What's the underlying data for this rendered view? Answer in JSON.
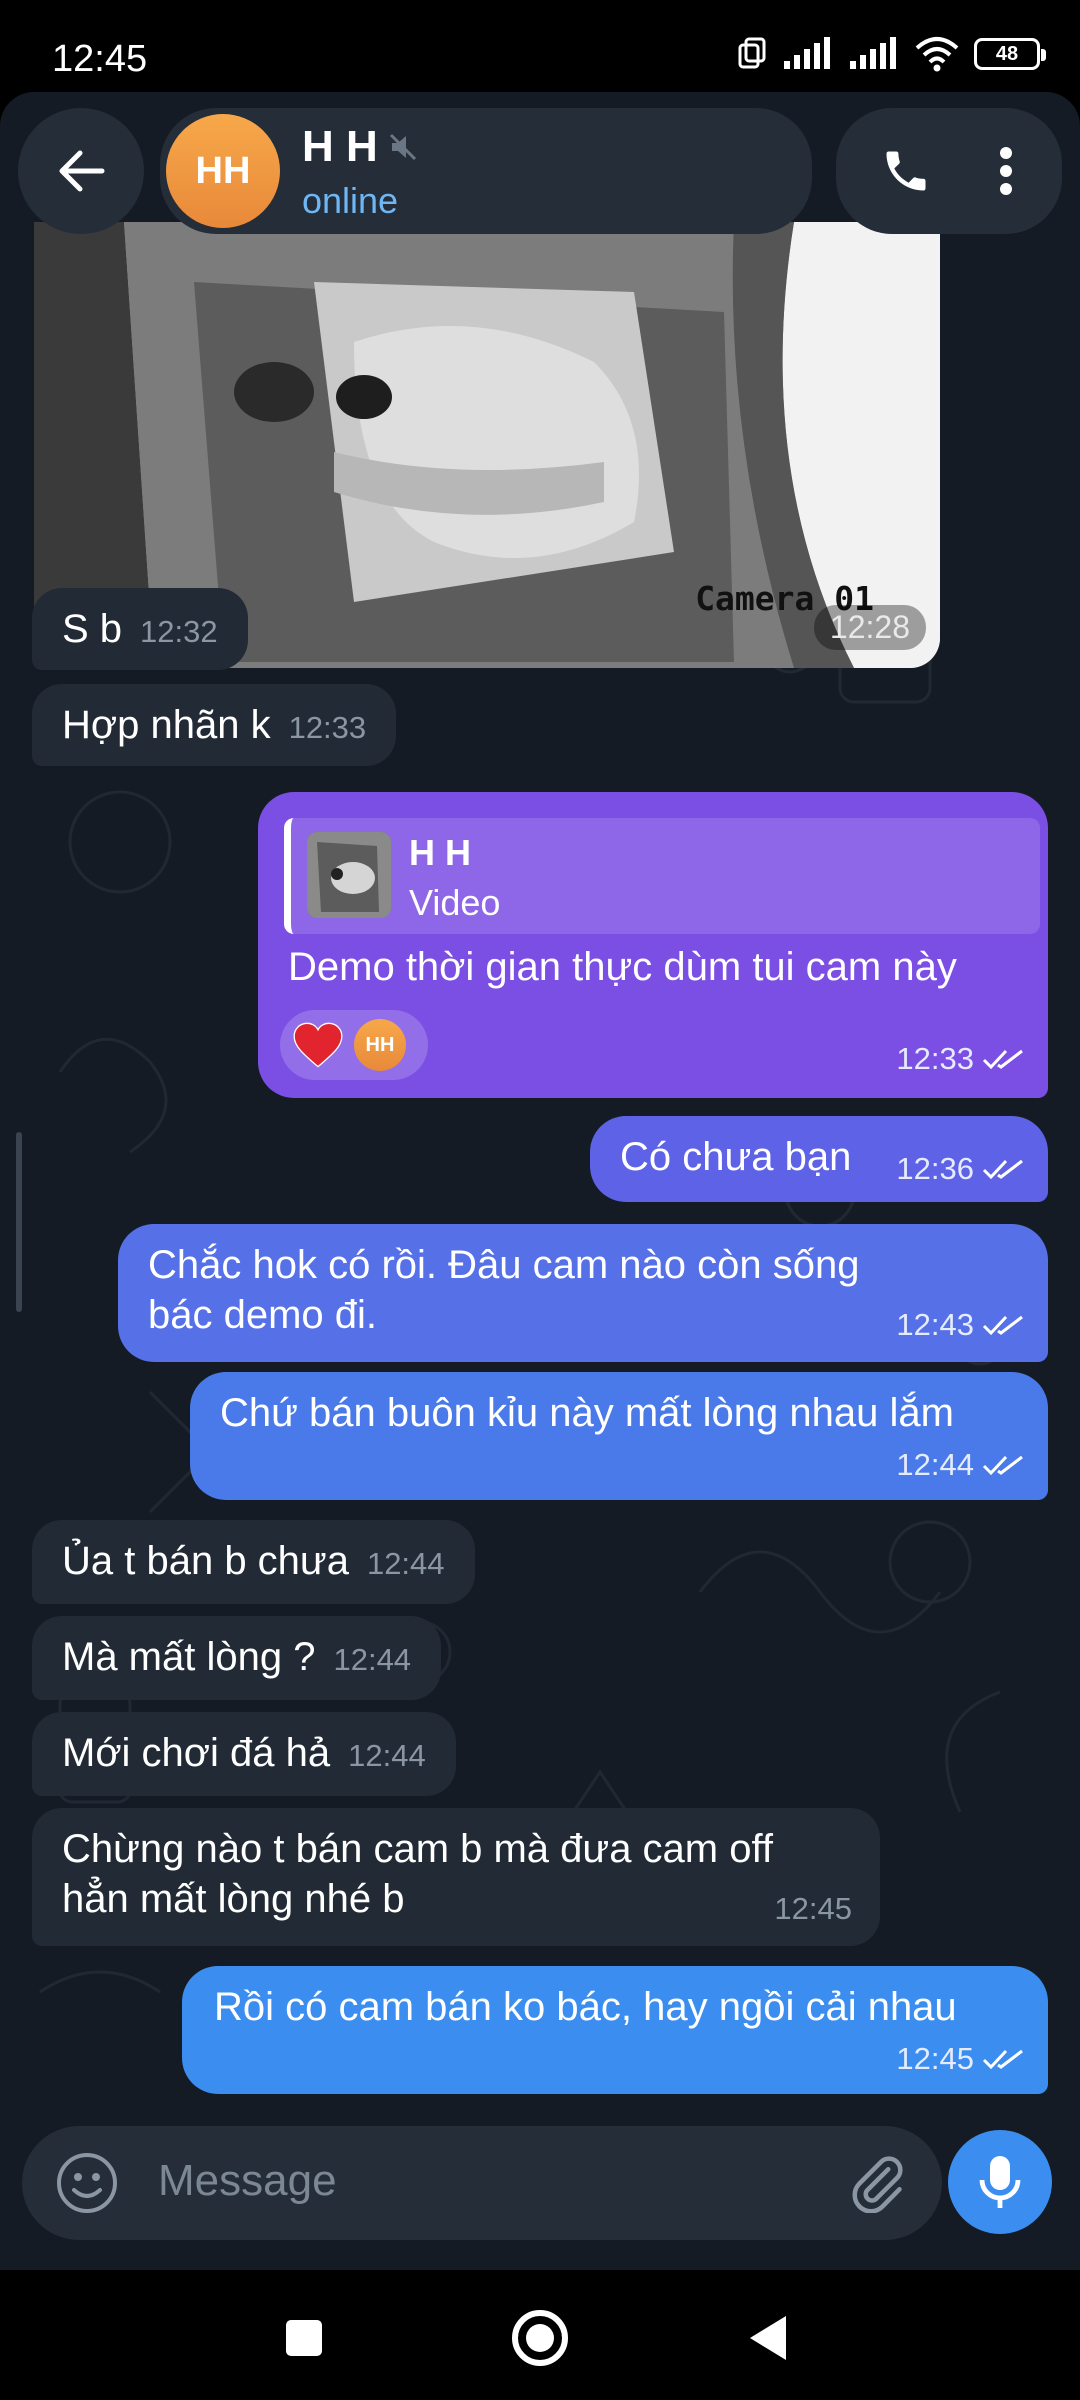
{
  "status_bar": {
    "time": "12:45",
    "battery": "48"
  },
  "header": {
    "avatar_initials": "HH",
    "name": "H H",
    "status": "online"
  },
  "photo": {
    "overlay_text": "Camera 01",
    "time": "12:28"
  },
  "messages": [
    {
      "side": "in",
      "text": "S b",
      "time": "12:32"
    },
    {
      "side": "in",
      "text": "Hợp nhãn k",
      "time": "12:33"
    },
    {
      "side": "out",
      "reply_name": "H H",
      "reply_type": "Video",
      "text": "Demo thời gian thực dùm tui cam này",
      "time": "12:33",
      "reaction_avatar": "HH"
    },
    {
      "side": "out",
      "text": "Có chưa bạn",
      "time": "12:36"
    },
    {
      "side": "out",
      "text": "Chắc hok có rồi. Đâu cam nào còn sống bác demo đi.",
      "time": "12:43"
    },
    {
      "side": "out",
      "text": "Chứ bán buôn kỉu này mất lòng nhau lắm",
      "time": "12:44"
    },
    {
      "side": "in",
      "text": "Ủa t bán b chưa",
      "time": "12:44"
    },
    {
      "side": "in",
      "text": "Mà mất lòng ?",
      "time": "12:44"
    },
    {
      "side": "in",
      "text": "Mới chơi đá hả",
      "time": "12:44"
    },
    {
      "side": "in",
      "text": "Chừng nào t bán cam b mà đưa cam off hẳn mất lòng nhé b",
      "time": "12:45"
    },
    {
      "side": "out",
      "text": "Rồi có cam bán ko bác, hay ngồi cải nhau",
      "time": "12:45"
    }
  ],
  "composer": {
    "placeholder": "Message"
  },
  "colors": {
    "chat_bg": "#141b24",
    "incoming": "#222b35",
    "outgoing_top": "#7b4fe3",
    "outgoing_bottom": "#3b8df0",
    "accent": "#3b8df0"
  },
  "icons": [
    "back-arrow-icon",
    "mute-icon",
    "phone-icon",
    "more-vert-icon",
    "double-check-icon",
    "heart-icon",
    "emoji-icon",
    "attach-icon",
    "mic-icon",
    "nav-square-icon",
    "nav-circle-icon",
    "nav-back-icon",
    "signal-icon",
    "wifi-icon",
    "sim-icon"
  ]
}
